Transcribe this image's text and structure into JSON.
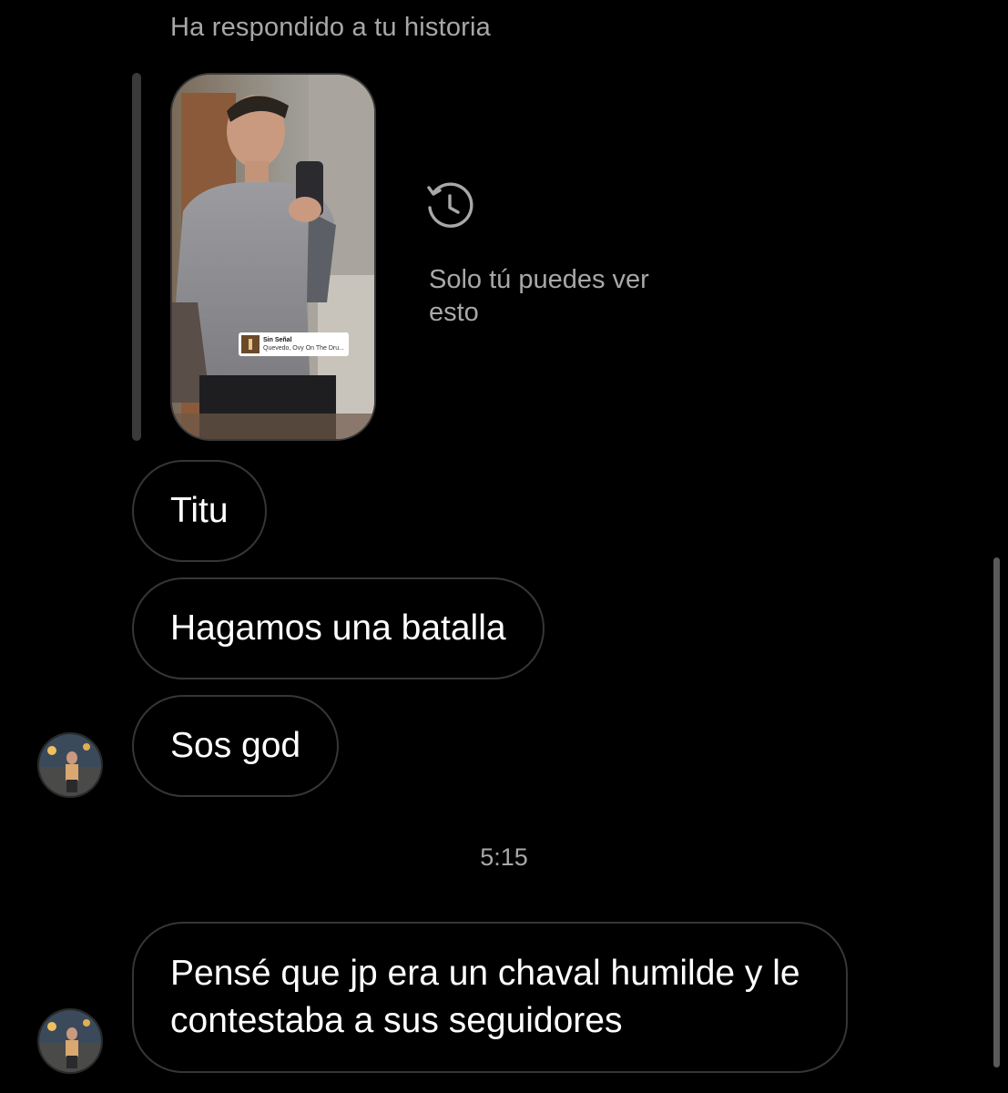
{
  "conversation": {
    "story_reply_label": "Ha respondido a tu historia",
    "story": {
      "music_sticker": {
        "title": "Sin Señal",
        "artist": "Quevedo, Ovy On The Dru..."
      },
      "private_note": "Solo tú puedes ver esto",
      "icon": "history-clock-icon"
    },
    "messages": [
      {
        "text": "Titu"
      },
      {
        "text": "Hagamos una batalla"
      },
      {
        "text": "Sos god"
      }
    ],
    "timestamp": "5:15",
    "last_message": {
      "text": "Pensé que jp era un chaval humilde y le contestaba a sus seguidores"
    }
  },
  "colors": {
    "background": "#000000",
    "bubble_border": "#363636",
    "secondary_text": "#a8a8a8"
  }
}
